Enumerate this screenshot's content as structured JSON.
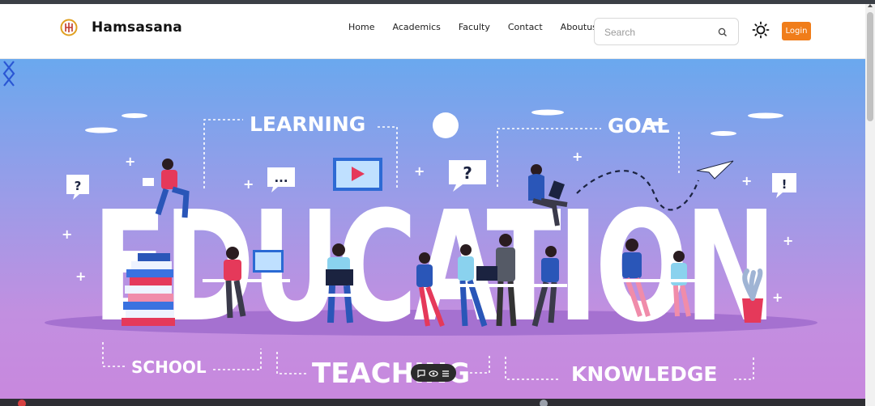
{
  "brand": {
    "name": "Hamsasana",
    "logo_icon": "lotus-logo-icon",
    "logo_color": "#e0a020"
  },
  "nav": {
    "items": [
      {
        "label": "Home"
      },
      {
        "label": "Academics"
      },
      {
        "label": "Faculty"
      },
      {
        "label": "Contact"
      },
      {
        "label": "Aboutus"
      }
    ]
  },
  "search": {
    "placeholder": "Search",
    "value": "",
    "icon": "search-icon"
  },
  "theme_toggle": {
    "icon": "sun-icon"
  },
  "login": {
    "label": "Login",
    "color": "#f07d1a"
  },
  "hero": {
    "headline": "EDUCATION",
    "keywords": {
      "learning": "LEARNING",
      "goal": "GOAL",
      "school": "SCHOOL",
      "teaching": "TEACHING",
      "knowledge": "KNOWLEDGE"
    },
    "bubbles": {
      "q1": "?",
      "dots": "...",
      "q2": "?",
      "excl": "!"
    },
    "gradient_top": "#6aa8ee",
    "gradient_bottom": "#c888de",
    "prev_icon": "chevron-left-icon",
    "next_icon": "chevron-right-icon"
  },
  "floating_toolbar": {
    "icons": [
      "chat-icon",
      "eye-icon",
      "menu-icon"
    ]
  }
}
